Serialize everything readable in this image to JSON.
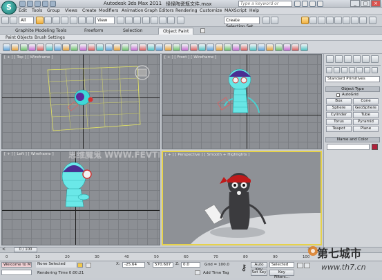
{
  "app": {
    "logo": "S",
    "title": "Autodesk 3ds Max  2011",
    "document": "怪怪陶瓷瓶文件.max",
    "help_placeholder": "Type a keyword or phrase"
  },
  "menu": [
    "Edit",
    "Tools",
    "Group",
    "Views",
    "Create",
    "Modifiers",
    "Animation",
    "Graph Editors",
    "Rendering",
    "Customize",
    "MAXScript",
    "Help"
  ],
  "toolbar": {
    "selection_filter": "All",
    "ref_coord": "View",
    "named_selection": "Create Selection Set"
  },
  "ribbon": {
    "tabs": [
      "Graphite Modeling Tools",
      "Freeform",
      "Selection",
      "Object Paint"
    ],
    "active_tab": "Object Paint",
    "sub_items": [
      "Paint Objects",
      "Brush Settings"
    ]
  },
  "viewports": [
    {
      "label": "[ + ] [ Top ] [ Wireframe ]"
    },
    {
      "label": "[ + ] [ Front ] [ Wireframe ]"
    },
    {
      "label": "[ + ] [ Left ] [ Wireframe ]"
    },
    {
      "label": "[ + ] [ Perspective ] [ Smooth + Highlights ]"
    }
  ],
  "viewport_watermark": "思维魔鬼 WWW.FEVTE.NET",
  "command_panel": {
    "category": "Standard Primitives",
    "object_type_title": "Object Type",
    "autogrid": "AutoGrid",
    "buttons": [
      "Box",
      "Cone",
      "Sphere",
      "GeoSphere",
      "Cylinder",
      "Tube",
      "Torus",
      "Pyramid",
      "Teapot",
      "Plane"
    ],
    "name_color_title": "Name and Color",
    "accent": "#b0203a"
  },
  "timeline": {
    "frame": "0 / 100"
  },
  "trackbar_ticks": [
    "0",
    "10",
    "20",
    "30",
    "40",
    "50",
    "60",
    "70",
    "80",
    "90",
    "100"
  ],
  "status": {
    "maxscript": "Welcome to MAX!",
    "selection": "None Selected",
    "prompt": "Rendering Time  0:00:21",
    "x_label": "X:",
    "x": "-25.64",
    "y_label": "Y:",
    "y": "570.607",
    "z_label": "Z:",
    "z": "0.0",
    "grid": "Grid = 100.0",
    "add_time_tag": "Add Time Tag",
    "auto_key": "Auto Key",
    "set_key": "Set Key",
    "key_mode": "Selected",
    "key_filters": "Key Filters..."
  },
  "watermark": {
    "site_cn": "第七城市",
    "site_url": "www.th7.cn"
  }
}
